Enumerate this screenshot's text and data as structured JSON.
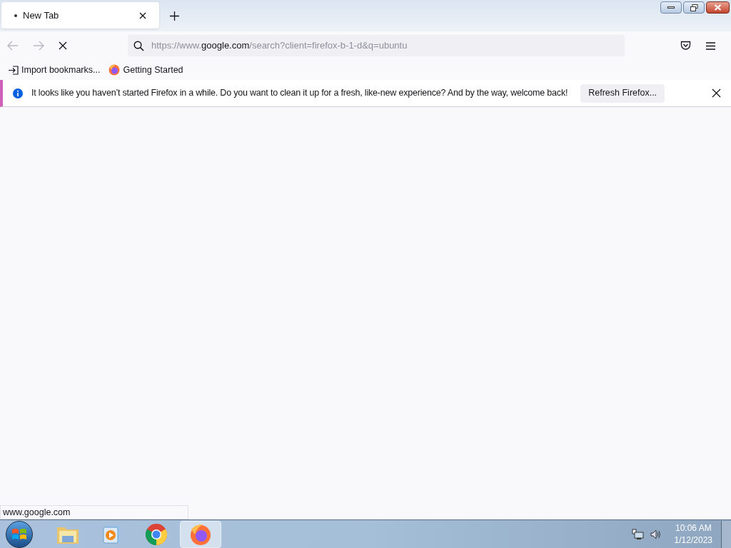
{
  "tabs": [
    {
      "label": "New Tab",
      "selected": true,
      "loading": true
    }
  ],
  "toolbar": {
    "back_disabled": true,
    "forward_disabled": true,
    "loading": true
  },
  "url": {
    "prefix": "https://www.",
    "domain": "google.com",
    "suffix": "/search?client=firefox-b-1-d&q=ubuntu"
  },
  "bookmarks": [
    {
      "kind": "import",
      "label": "Import bookmarks..."
    },
    {
      "kind": "firefox",
      "label": "Getting Started"
    }
  ],
  "notification": {
    "message": "It looks like you haven’t started Firefox in a while. Do you want to clean it up for a fresh, like-new experience? And by the way, welcome back!",
    "button": "Refresh Firefox..."
  },
  "status_text": "www.google.com",
  "taskbar": {
    "apps": [
      {
        "kind": "explorer",
        "selected": false
      },
      {
        "kind": "media",
        "selected": false
      },
      {
        "kind": "chrome",
        "selected": false
      },
      {
        "kind": "firefox",
        "selected": true
      }
    ],
    "time": "10:06 AM",
    "date": "1/12/2023"
  }
}
